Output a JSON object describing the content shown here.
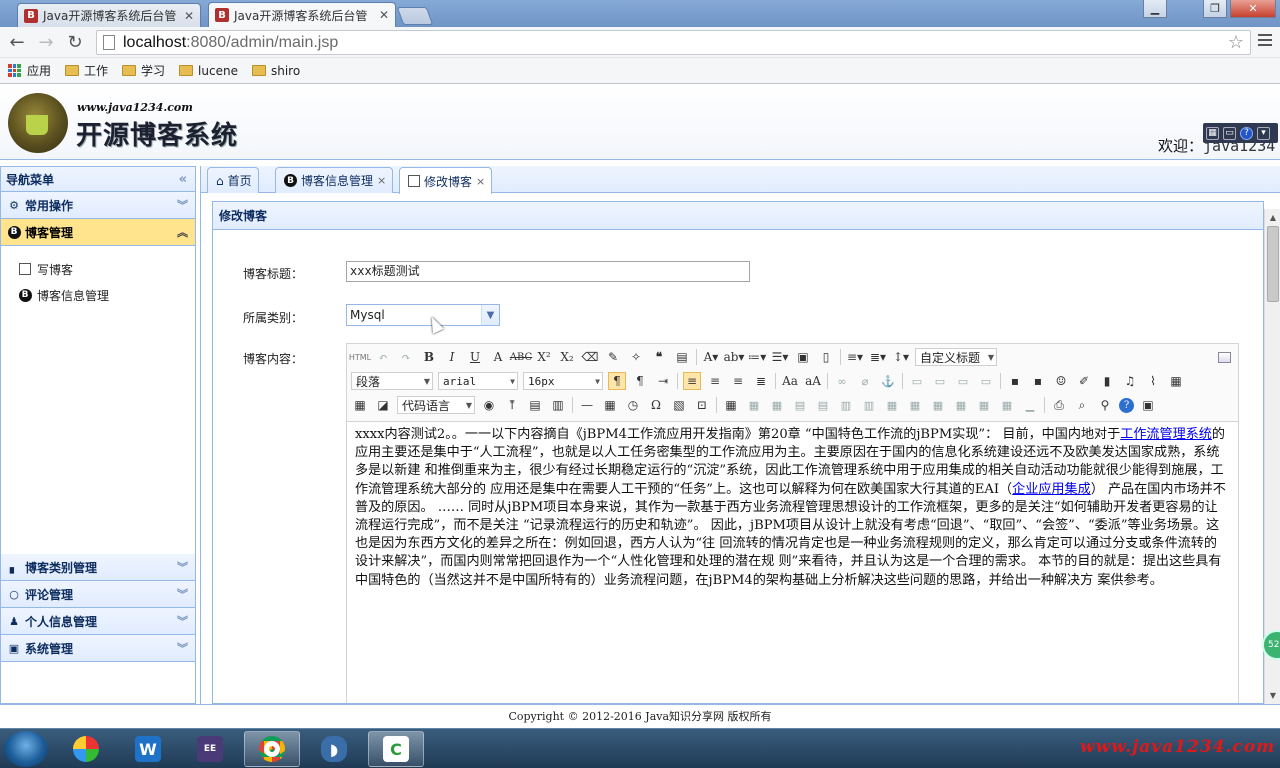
{
  "browser": {
    "tabs": [
      {
        "favicon": "B",
        "title": "Java开源博客系统后台管"
      },
      {
        "favicon": "B",
        "title": "Java开源博客系统后台管"
      }
    ],
    "url_host": "localhost",
    "url_path": ":8080/admin/main.jsp",
    "bookmarks": [
      {
        "label": "应用",
        "icon": "apps-grid-icon"
      },
      {
        "label": "工作",
        "icon": "folder-icon"
      },
      {
        "label": "学习",
        "icon": "folder-icon"
      },
      {
        "label": "lucene",
        "icon": "folder-icon"
      },
      {
        "label": "shiro",
        "icon": "folder-icon"
      }
    ]
  },
  "header": {
    "site": "www.java1234.com",
    "name": "开源博客系统",
    "welcome": "欢迎：",
    "user": "java1234"
  },
  "west": {
    "title": "导航菜单",
    "sections": [
      {
        "label": "常用操作",
        "icon": "gear-icon"
      },
      {
        "label": "博客管理",
        "icon": "blog-icon",
        "selected": true,
        "items": [
          {
            "label": "写博客",
            "icon": "edit-icon"
          },
          {
            "label": "博客信息管理",
            "icon": "blog-icon"
          }
        ]
      },
      {
        "label": "博客类别管理",
        "icon": "category-icon"
      },
      {
        "label": "评论管理",
        "icon": "comment-icon"
      },
      {
        "label": "个人信息管理",
        "icon": "user-icon"
      },
      {
        "label": "系统管理",
        "icon": "system-icon"
      }
    ]
  },
  "center": {
    "tabs": [
      {
        "label": "首页",
        "icon": "home-icon",
        "closable": false
      },
      {
        "label": "博客信息管理",
        "icon": "blog-icon",
        "closable": true
      },
      {
        "label": "修改博客",
        "icon": "edit-icon",
        "closable": true,
        "active": true
      }
    ],
    "panel_title": "修改博客",
    "form": {
      "title_label": "博客标题：",
      "title_value": "xxx标题测试",
      "type_label": "所属类别：",
      "type_value": "Mysql",
      "content_label": "博客内容："
    },
    "editor": {
      "block_format": "段落",
      "font_family": "arial",
      "font_size": "16px",
      "custom_title": "自定义标题",
      "code_lang": "代码语言",
      "html_btn": "HTML",
      "content_before_link1": "xxxx内容测试2。。一一以下内容摘自《jBPM4工作流应用开发指南》第20章 “中国特色工作流的jBPM实现”： 目前，中国内地对于",
      "link1": "工作流管理系统",
      "content_between": "的 应用主要还是集中于“人工流程”，也就是以人工任务密集型的工作流应用为主。主要原因在于国内的信息化系统建设还远不及欧美发达国家成熟，系统多是以新建 和推倒重来为主，很少有经过长期稳定运行的“沉淀”系统，因此工作流管理系统中用于应用集成的相关自动活动功能就很少能得到施展，工作流管理系统大部分的 应用还是集中在需要人工干预的“任务”上。这也可以解释为何在欧美国家大行其道的EAI（",
      "link2": "企业应用集成",
      "content_after": "） 产品在国内市场并不普及的原因。 …… 同时从jBPM项目本身来说，其作为一款基于西方业务流程管理思想设计的工作流框架，更多的是关注“如何辅助开发者更容易的让流程运行完成”，而不是关注 “记录流程运行的历史和轨迹”。 因此，jBPM项目从设计上就没有考虑“回退”、“取回”、“会签”、“委派”等业务场景。这也是因为东西方文化的差异之所在：例如回退，西方人认为“往 回流转的情况肯定也是一种业务流程规则的定义，那么肯定可以通过分支或条件流转的设计来解决”，而国内则常常把回退作为一个“人性化管理和处理的潜在规 则”来看待，并且认为这是一个合理的需求。 本节的目的就是：提出这些具有中国特色的（当然这并不是中国所特有的）业务流程问题，在jBPM4的架构基础上分析解决这些问题的思路，并给出一种解决方 案供参考。"
    }
  },
  "footer": "Copyright © 2012-2016 Java知识分享网 版权所有",
  "taskbar": {
    "apps": [
      "start-orb-icon",
      "app-icon",
      "word-icon",
      "eclipse-icon",
      "chrome-icon",
      "dolphin-icon",
      "camtasia-icon"
    ],
    "watermark": "www.java1234.com"
  },
  "floating_badge": "52",
  "colors": {
    "panel_border": "#95b8e7",
    "panel_header": "#e0ecff",
    "selected_section": "#ffe48d",
    "link": "#0000ee",
    "watermark": "#e01818"
  }
}
